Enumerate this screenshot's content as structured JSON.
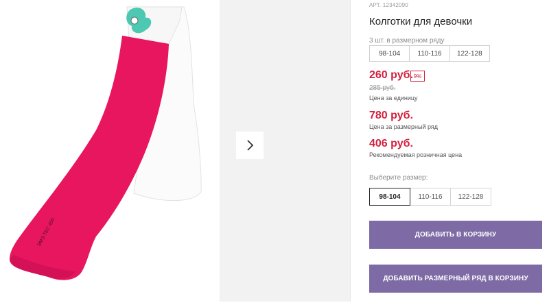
{
  "product": {
    "article": "АРТ. 12342090",
    "title": "Колготки для девочки"
  },
  "size_set": {
    "label": "3 шт. в размерном ряду",
    "sizes": [
      "98-104",
      "110-116",
      "122-128"
    ]
  },
  "prices": {
    "unit_price": "260 руб.",
    "discount": "9%",
    "old_price": "285 руб.",
    "unit_caption": "Цена за единицу",
    "set_price": "780 руб.",
    "set_caption": "Цена за размерный ряд",
    "rrp_price": "406 руб.",
    "rrp_caption": "Рекомендуемая розничная цена"
  },
  "size_select": {
    "label": "Выберите размер:",
    "options": [
      "98-104",
      "110-116",
      "122-128"
    ],
    "selected": "98-104"
  },
  "buttons": {
    "add_to_cart": "ДОБАВИТЬ В КОРЗИНУ",
    "add_set_to_cart": "ДОБАВИТЬ РАЗМЕРНЫЙ РЯД В КОРЗИНУ"
  },
  "gallery": {
    "image_text": "ЭМЭ ТЕС 400",
    "next_icon": "chevron-right-icon"
  },
  "colors": {
    "price_red": "#d21f3c",
    "button_purple": "#7e6aa4",
    "tights_pink": "#e8155f"
  }
}
